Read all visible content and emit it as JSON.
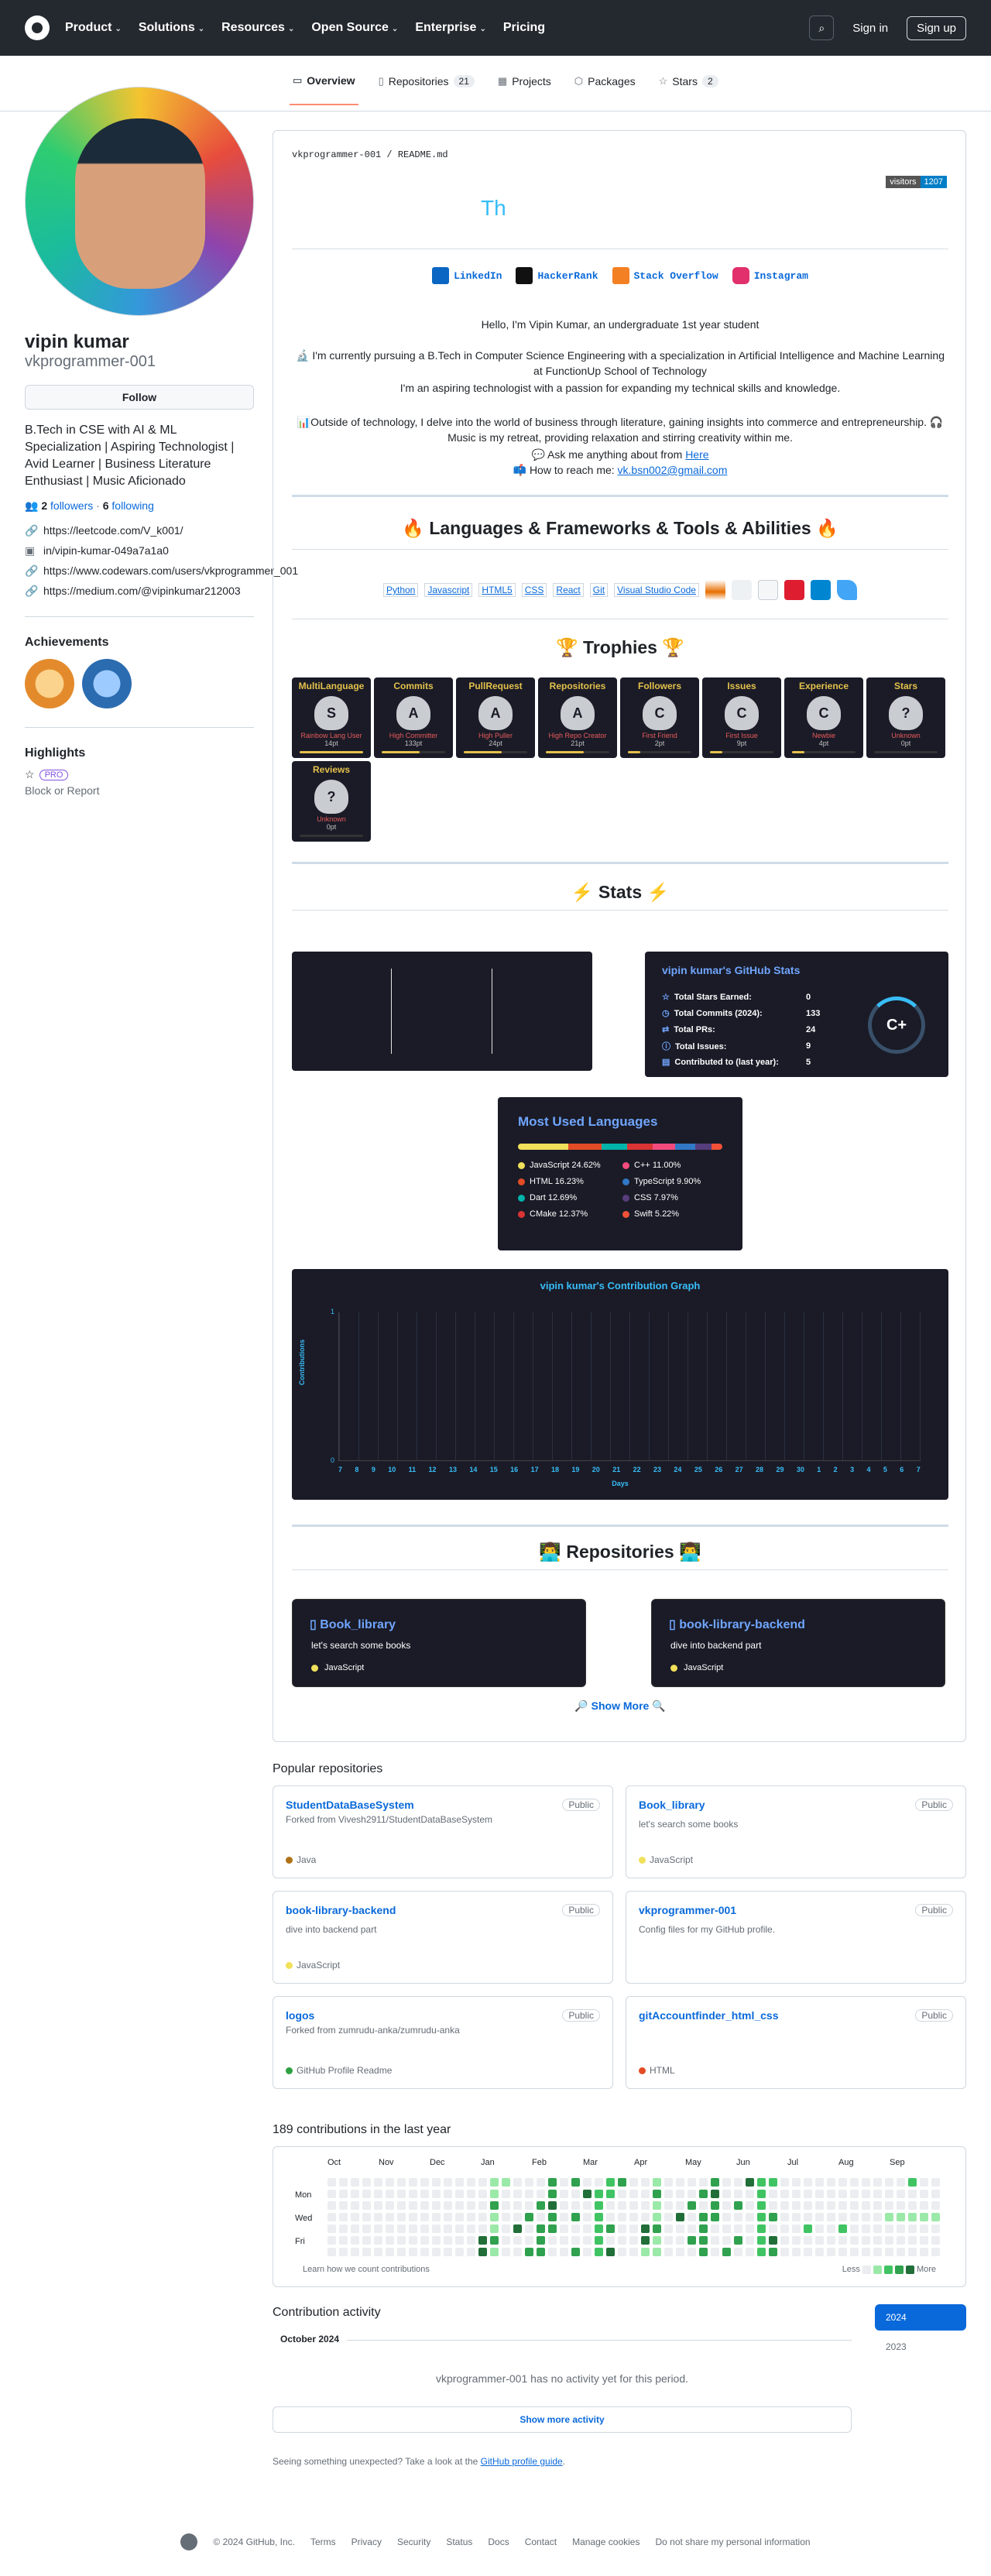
{
  "header": {
    "nav": [
      "Product",
      "Solutions",
      "Resources",
      "Open Source",
      "Enterprise",
      "Pricing"
    ],
    "signin": "Sign in",
    "signup": "Sign up"
  },
  "tabs": [
    {
      "label": "Overview"
    },
    {
      "label": "Repositories",
      "count": "21"
    },
    {
      "label": "Projects"
    },
    {
      "label": "Packages"
    },
    {
      "label": "Stars",
      "count": "2"
    }
  ],
  "profile": {
    "fullname": "vipin kumar",
    "username": "vkprogrammer-001",
    "follow": "Follow",
    "bio": "B.Tech in CSE with AI & ML Specialization | Aspiring Technologist | Avid Learner | Business Literature Enthusiast | Music Aficionado",
    "followers": "2",
    "followers_label": "followers",
    "following": "6",
    "following_label": "following",
    "links": [
      "https://leetcode.com/V_k001/",
      "in/vipin-kumar-049a7a1a0",
      "https://www.codewars.com/users/vkprogrammer_001",
      "https://medium.com/@vipinkumar212003"
    ],
    "achievements": "Achievements",
    "highlights": "Highlights",
    "pro": "PRO",
    "block": "Block or Report"
  },
  "readme": {
    "path": "vkprogrammer-001 / README.md",
    "visitors_label": "visitors",
    "visitors_count": "1207",
    "typing": "Th",
    "social": [
      "LinkedIn",
      "HackerRank",
      "Stack Overflow",
      "Instagram"
    ],
    "hello": "Hello, I'm Vipin Kumar, an undergraduate 1st year student",
    "para1": "🔬 I'm currently pursuing a B.Tech in Computer Science Engineering with a specialization in Artificial Intelligence and Machine Learning at FunctionUp School of Technology",
    "para2": "I'm an aspiring technologist with a passion for expanding my technical skills and knowledge.",
    "para3": "📊Outside of technology, I delve into the world of business through literature, gaining insights into commerce and entrepreneurship. 🎧 Music is my retreat, providing relaxation and stirring creativity within me.",
    "ask": "💬 Ask me anything about from ",
    "ask_link": "Here",
    "reach": "📫 How to reach me: ",
    "email": "vk.bsn002@gmail.com",
    "h_lang": "🔥 Languages & Frameworks & Tools & Abilities 🔥",
    "tech": [
      "Python",
      "Javascript",
      "HTML5",
      "CSS",
      "React",
      "Git",
      "Visual Studio Code"
    ],
    "h_trophies": "🏆 Trophies 🏆",
    "trophies": [
      {
        "title": "MultiLanguage",
        "rank": "S",
        "sub": "Rainbow Lang User",
        "pt": "14pt",
        "progress": 1.0
      },
      {
        "title": "Commits",
        "rank": "A",
        "sub": "High Committer",
        "pt": "133pt",
        "progress": 0.6
      },
      {
        "title": "PullRequest",
        "rank": "A",
        "sub": "High Puller",
        "pt": "24pt",
        "progress": 0.6
      },
      {
        "title": "Repositories",
        "rank": "A",
        "sub": "High Repo Creator",
        "pt": "21pt",
        "progress": 0.6
      },
      {
        "title": "Followers",
        "rank": "C",
        "sub": "First Friend",
        "pt": "2pt",
        "progress": 0.2
      },
      {
        "title": "Issues",
        "rank": "C",
        "sub": "First Issue",
        "pt": "9pt",
        "progress": 0.2
      },
      {
        "title": "Experience",
        "rank": "C",
        "sub": "Newbie",
        "pt": "4pt",
        "progress": 0.2
      },
      {
        "title": "Stars",
        "rank": "?",
        "sub": "Unknown",
        "pt": "0pt",
        "progress": 0
      },
      {
        "title": "Reviews",
        "rank": "?",
        "sub": "Unknown",
        "pt": "0pt",
        "progress": 0
      }
    ],
    "h_stats": "⚡ Stats ⚡",
    "stats_title": "vipin kumar's GitHub Stats",
    "stats": [
      {
        "label": "Total Stars Earned:",
        "value": "0"
      },
      {
        "label": "Total Commits (2024):",
        "value": "133"
      },
      {
        "label": "Total PRs:",
        "value": "24"
      },
      {
        "label": "Total Issues:",
        "value": "9"
      },
      {
        "label": "Contributed to (last year):",
        "value": "5"
      }
    ],
    "grade": "C+",
    "langs_title": "Most Used Languages",
    "langs": [
      {
        "name": "JavaScript 24.62%",
        "color": "#f1e05a",
        "pct": 24.62
      },
      {
        "name": "C++ 11.00%",
        "color": "#f34b7d",
        "pct": 11.0
      },
      {
        "name": "HTML 16.23%",
        "color": "#e34c26",
        "pct": 16.23
      },
      {
        "name": "TypeScript 9.90%",
        "color": "#3178c6",
        "pct": 9.9
      },
      {
        "name": "Dart 12.69%",
        "color": "#00b4ab",
        "pct": 12.69
      },
      {
        "name": "CSS 7.97%",
        "color": "#563d7c",
        "pct": 7.97
      },
      {
        "name": "CMake 12.37%",
        "color": "#da3434",
        "pct": 12.37
      },
      {
        "name": "Swift 5.22%",
        "color": "#f05138",
        "pct": 5.22
      }
    ],
    "graph_title": "vipin kumar's Contribution Graph",
    "graph_ylabel": "Contributions",
    "graph_xlabel": "Days",
    "graph_ymax": "1",
    "graph_ymin": "0",
    "graph_days": [
      "7",
      "8",
      "9",
      "10",
      "11",
      "12",
      "13",
      "14",
      "15",
      "16",
      "17",
      "18",
      "19",
      "20",
      "21",
      "22",
      "23",
      "24",
      "25",
      "26",
      "27",
      "28",
      "29",
      "30",
      "1",
      "2",
      "3",
      "4",
      "5",
      "6",
      "7"
    ],
    "h_repos": "👨‍💻 Repositories 👨‍💻",
    "repo_cards": [
      {
        "name": "Book_library",
        "desc": "let's search some books",
        "lang": "JavaScript"
      },
      {
        "name": "book-library-backend",
        "desc": "dive into backend part",
        "lang": "JavaScript"
      }
    ],
    "show_more": "🔎 Show More 🔍"
  },
  "popular": {
    "title": "Popular repositories",
    "public": "Public",
    "repos": [
      {
        "name": "StudentDataBaseSystem",
        "forked": "Forked from Vivesh2911/StudentDataBaseSystem",
        "desc": "",
        "lang": "Java",
        "color": "#b07219"
      },
      {
        "name": "Book_library",
        "forked": "",
        "desc": "let's search some books",
        "lang": "JavaScript",
        "color": "#f1e05a"
      },
      {
        "name": "book-library-backend",
        "forked": "",
        "desc": "dive into backend part",
        "lang": "JavaScript",
        "color": "#f1e05a"
      },
      {
        "name": "vkprogrammer-001",
        "forked": "",
        "desc": "Config files for my GitHub profile.",
        "lang": "",
        "color": ""
      },
      {
        "name": "logos",
        "forked": "Forked from zumrudu-anka/zumrudu-anka",
        "desc": "",
        "lang": "GitHub Profile Readme",
        "color": "#2ea043"
      },
      {
        "name": "gitAccountfinder_html_css",
        "forked": "",
        "desc": "",
        "lang": "HTML",
        "color": "#e34c26"
      }
    ]
  },
  "contrib": {
    "title": "189 contributions in the last year",
    "months": [
      "Oct",
      "Nov",
      "Dec",
      "Jan",
      "Feb",
      "Mar",
      "Apr",
      "May",
      "Jun",
      "Jul",
      "Aug",
      "Sep"
    ],
    "days": [
      "Mon",
      "Wed",
      "Fri"
    ],
    "learn": "Learn how we count contributions",
    "less": "Less",
    "more": "More",
    "levels_color": [
      "#ebedf0",
      "#9be9a8",
      "#40c463",
      "#30a14e",
      "#216e39"
    ]
  },
  "activity": {
    "title": "Contribution activity",
    "month": "October 2024",
    "empty": "vkprogrammer-001 has no activity yet for this period.",
    "show_more": "Show more activity",
    "years": [
      "2024",
      "2023"
    ],
    "hint": "Seeing something unexpected? Take a look at the ",
    "hint_link": "GitHub profile guide",
    "hint_end": "."
  },
  "footer": {
    "copy": "© 2024 GitHub, Inc.",
    "links": [
      "Terms",
      "Privacy",
      "Security",
      "Status",
      "Docs",
      "Contact",
      "Manage cookies",
      "Do not share my personal information"
    ]
  }
}
